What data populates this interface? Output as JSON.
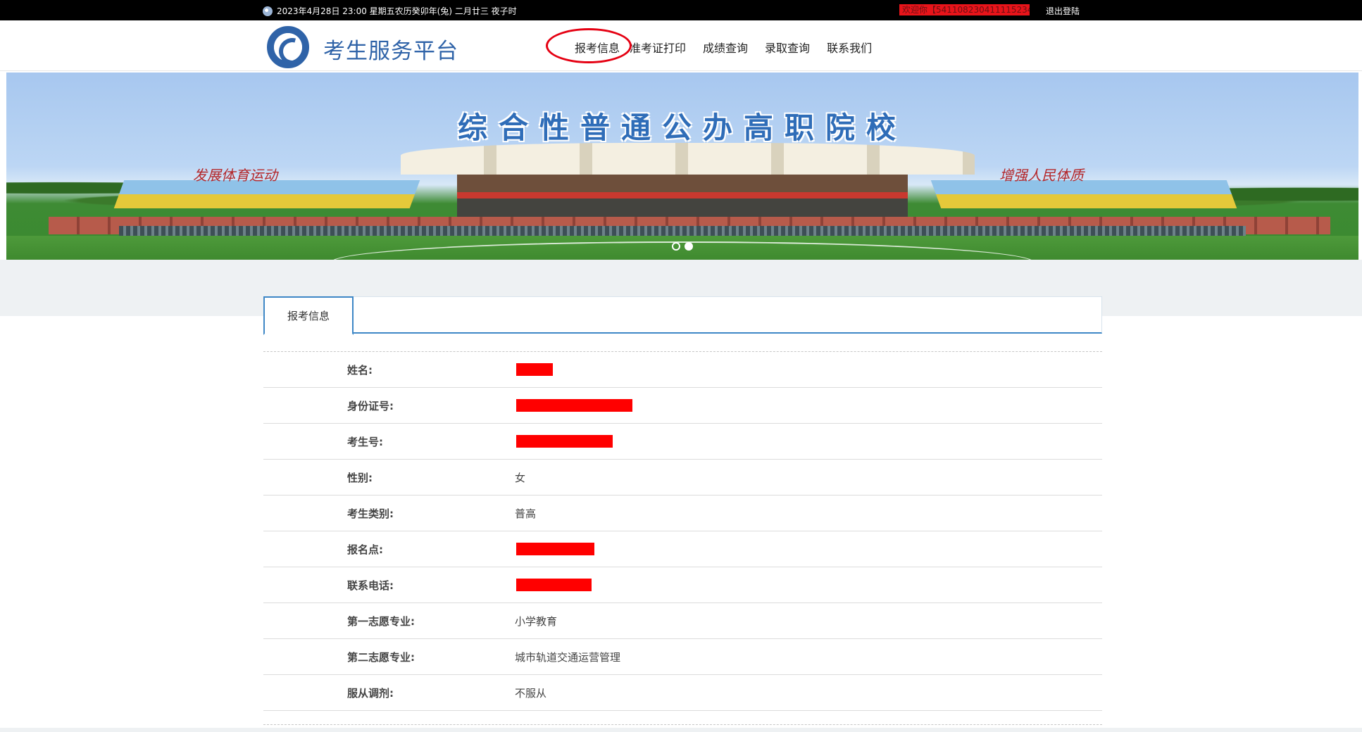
{
  "topbar": {
    "datetime": "2023年4月28日 23:00 星期五农历癸卯年(兔) 二月廿三 夜子时",
    "user_info": "欢迎你【5411082304111152348】",
    "logout_label": "退出登陆"
  },
  "header": {
    "brand": "考生服务平台",
    "nav": [
      "报考信息",
      "准考证打印",
      "成绩查询",
      "录取查询",
      "联系我们"
    ]
  },
  "banner": {
    "title": "综合性普通公办高职院校",
    "left_slogan": "发展体育运动",
    "right_slogan": "增强人民体质"
  },
  "tab": {
    "label": "报考信息"
  },
  "fields": [
    {
      "label": "姓名:",
      "value": "",
      "redacted": true
    },
    {
      "label": "身份证号:",
      "value": "",
      "redacted": true
    },
    {
      "label": "考生号:",
      "value": "",
      "redacted": true
    },
    {
      "label": "性别:",
      "value": "女",
      "redacted": false
    },
    {
      "label": "考生类别:",
      "value": "普高",
      "redacted": false
    },
    {
      "label": "报名点:",
      "value": "",
      "redacted": true
    },
    {
      "label": "联系电话:",
      "value": "",
      "redacted": true
    },
    {
      "label": "第一志愿专业:",
      "value": "小学教育",
      "redacted": false
    },
    {
      "label": "第二志愿专业:",
      "value": "城市轨道交通运营管理",
      "redacted": false
    },
    {
      "label": "服从调剂:",
      "value": "不服从",
      "redacted": false
    }
  ],
  "colors": {
    "accent": "#3e87c6",
    "brand": "#2f63a8",
    "highlight": "#e50012",
    "redaction": "#ff0000"
  }
}
